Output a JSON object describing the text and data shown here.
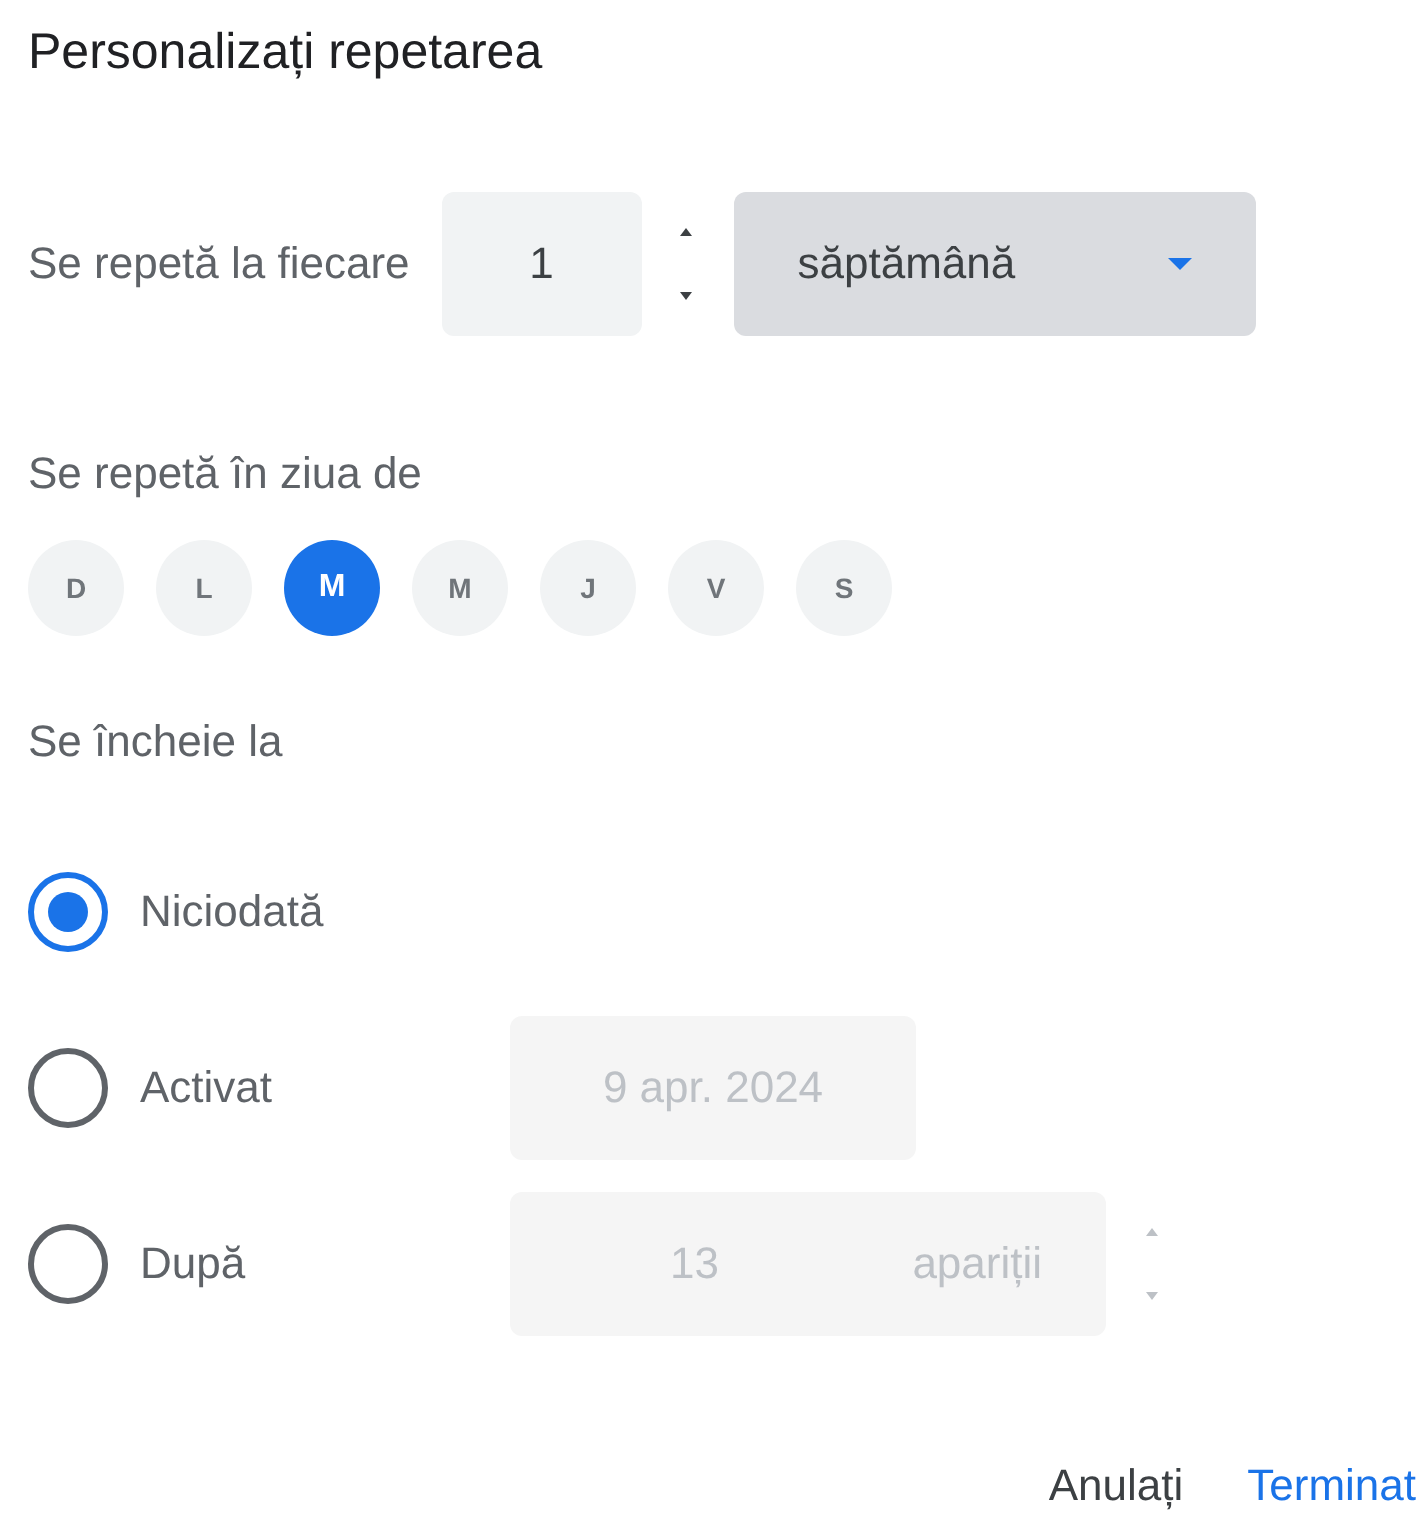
{
  "title": "Personalizați repetarea",
  "repeat": {
    "label": "Se repetă la fiecare",
    "value": "1",
    "unit": "săptămână"
  },
  "days": {
    "label": "Se repetă în ziua de",
    "items": [
      {
        "letter": "D",
        "selected": false
      },
      {
        "letter": "L",
        "selected": false
      },
      {
        "letter": "M",
        "selected": true
      },
      {
        "letter": "M",
        "selected": false
      },
      {
        "letter": "J",
        "selected": false
      },
      {
        "letter": "V",
        "selected": false
      },
      {
        "letter": "S",
        "selected": false
      }
    ]
  },
  "ends": {
    "label": "Se încheie la",
    "options": [
      {
        "kind": "never",
        "label": "Niciodată",
        "selected": true
      },
      {
        "kind": "date",
        "label": "Activat",
        "selected": false,
        "value": "9 apr. 2024"
      },
      {
        "kind": "count",
        "label": "După",
        "selected": false,
        "value": "13",
        "unit": "apariții"
      }
    ]
  },
  "buttons": [
    {
      "kind": "cancel",
      "label": "Anulați"
    },
    {
      "kind": "done",
      "label": "Terminat"
    }
  ]
}
